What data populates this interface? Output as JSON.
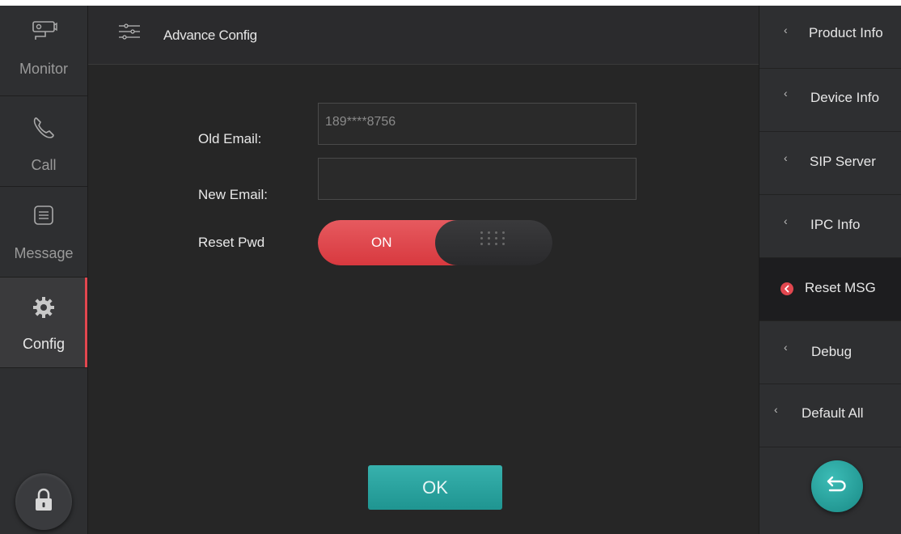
{
  "sidebar": {
    "items": [
      {
        "label": "Monitor",
        "icon": "camera-icon"
      },
      {
        "label": "Call",
        "icon": "phone-icon"
      },
      {
        "label": "Message",
        "icon": "message-list-icon"
      },
      {
        "label": "Config",
        "icon": "gear-icon",
        "active": true
      }
    ],
    "lock_icon": "lock-icon"
  },
  "header": {
    "title": "Advance Config",
    "icon": "sliders-icon"
  },
  "form": {
    "old_email": {
      "label": "Old Email:",
      "value": "189****8756"
    },
    "new_email": {
      "label": "New Email:",
      "value": ""
    },
    "reset_pwd": {
      "label": "Reset Pwd",
      "state": "ON"
    },
    "ok_label": "OK"
  },
  "right_menu": {
    "items": [
      {
        "label": "Product Info"
      },
      {
        "label": "Device Info"
      },
      {
        "label": "SIP Server"
      },
      {
        "label": "IPC Info"
      },
      {
        "label": "Reset MSG",
        "active": true
      },
      {
        "label": "Debug"
      },
      {
        "label": "Default All"
      }
    ],
    "back_icon": "back-arrow-icon"
  },
  "colors": {
    "accent_red": "#e2474f",
    "accent_teal": "#2aa5a1",
    "background": "#262626"
  }
}
